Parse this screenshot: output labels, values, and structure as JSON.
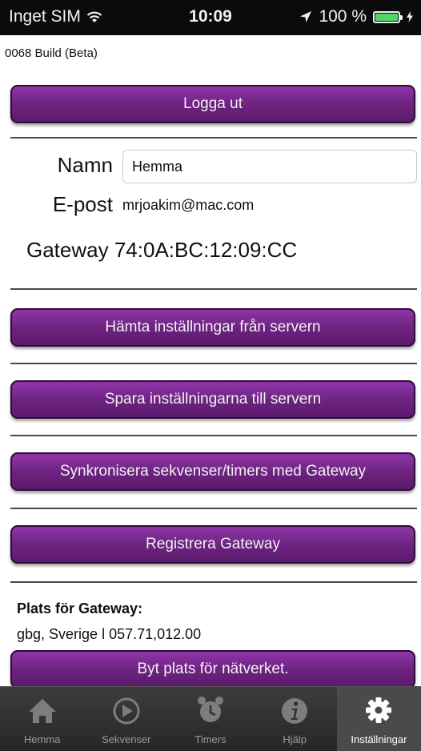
{
  "status_bar": {
    "carrier": "Inget SIM",
    "time": "10:09",
    "battery_text": "100 %",
    "battery_level": 1.0,
    "wifi_icon": "wifi-icon",
    "location_icon": "location-arrow-icon",
    "battery_icon": "battery-icon"
  },
  "build_label": "0068 Build (Beta)",
  "buttons": {
    "logout": "Logga ut",
    "fetch_settings": "Hämta inställningar från servern",
    "save_settings": "Spara inställningarna till servern",
    "sync": "Synkronisera sekvenser/timers med Gateway",
    "register": "Registrera Gateway",
    "change_location": "Byt plats för nätverket."
  },
  "account": {
    "name_label": "Namn",
    "name_value": "Hemma",
    "email_label": "E-post",
    "email_value": "mrjoakim@mac.com",
    "gateway_label": "Gateway",
    "gateway_value": "74:0A:BC:12:09:CC"
  },
  "location": {
    "title": "Plats för Gateway:",
    "value": "gbg, Sverige l 057.71,012.00"
  },
  "tabs": [
    {
      "label": "Hemma",
      "icon": "home-icon",
      "active": false
    },
    {
      "label": "Sekvenser",
      "icon": "play-circle-icon",
      "active": false
    },
    {
      "label": "Timers",
      "icon": "alarm-clock-icon",
      "active": false
    },
    {
      "label": "Hjälp",
      "icon": "info-icon",
      "active": false
    },
    {
      "label": "Inställningar",
      "icon": "gear-icon",
      "active": true
    }
  ],
  "colors": {
    "button_purple": "#6d2380",
    "status_bar": "#0b0b0b",
    "battery_green": "#4cd964",
    "tab_bar": "#2f2f2f"
  }
}
